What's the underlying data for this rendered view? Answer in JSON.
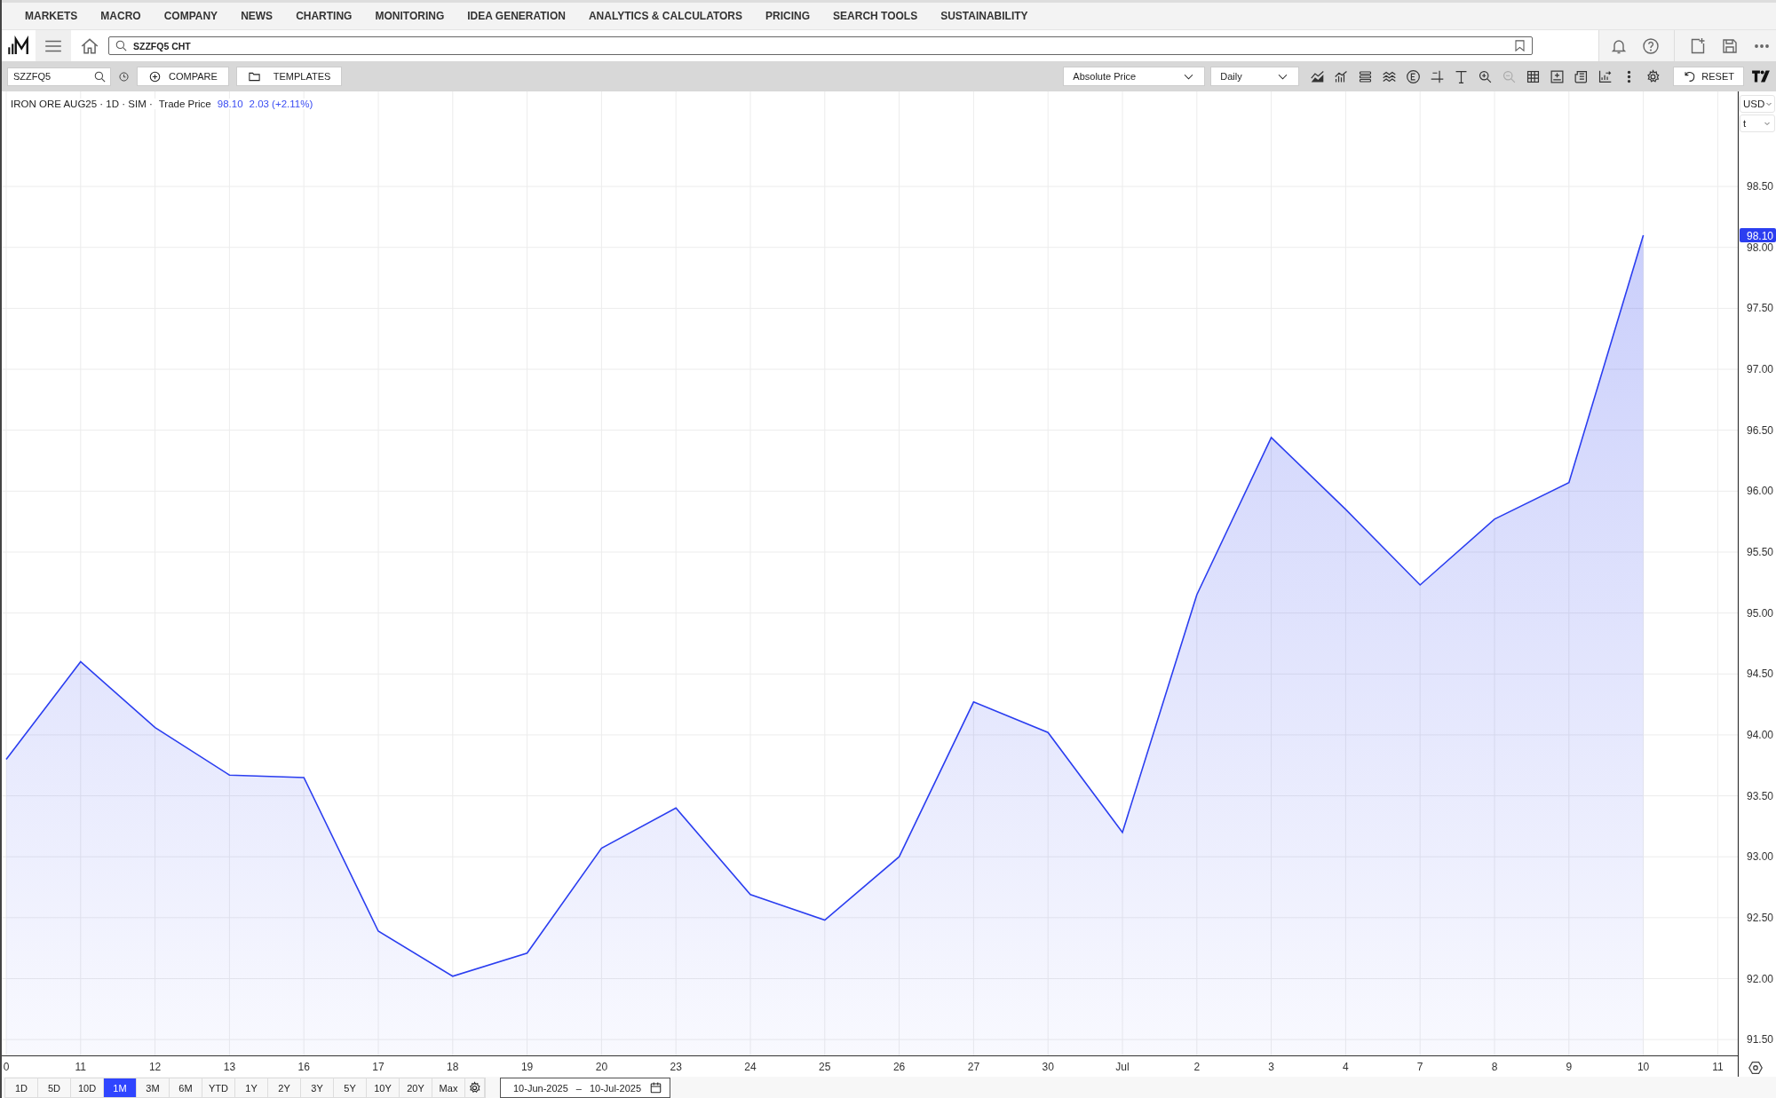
{
  "nav": {
    "items": [
      {
        "label": "MARKETS"
      },
      {
        "label": "MACRO"
      },
      {
        "label": "COMPANY"
      },
      {
        "label": "NEWS"
      },
      {
        "label": "CHARTING"
      },
      {
        "label": "MONITORING"
      },
      {
        "label": "IDEA GENERATION"
      },
      {
        "label": "ANALYTICS & CALCULATORS"
      },
      {
        "label": "PRICING"
      },
      {
        "label": "SEARCH TOOLS"
      },
      {
        "label": "SUSTAINABILITY"
      }
    ]
  },
  "command_bar": {
    "search_value": "SZZFQ5 CHT"
  },
  "toolbar": {
    "symbol_value": "SZZFQ5",
    "compare_label": "COMPARE",
    "templates_label": "TEMPLATES",
    "price_mode": "Absolute Price",
    "frequency": "Daily",
    "tools": [
      {
        "kind": "area",
        "disabled": false
      },
      {
        "kind": "indicators",
        "disabled": false
      },
      {
        "kind": "stack",
        "disabled": false
      },
      {
        "kind": "waves",
        "disabled": false
      },
      {
        "kind": "events",
        "disabled": false
      },
      {
        "kind": "crosshair",
        "disabled": false
      },
      {
        "kind": "text",
        "disabled": false
      },
      {
        "kind": "zoom-in",
        "disabled": false
      },
      {
        "kind": "zoom-out",
        "disabled": true
      },
      {
        "kind": "table",
        "disabled": false
      },
      {
        "kind": "frame",
        "disabled": false
      },
      {
        "kind": "news",
        "disabled": false
      },
      {
        "kind": "export",
        "disabled": false
      },
      {
        "kind": "more",
        "disabled": false
      },
      {
        "kind": "settings",
        "disabled": false
      }
    ],
    "reset_label": "RESET"
  },
  "chart": {
    "legend": {
      "title": "IRON ORE AUG25 · 1D · SIM ·",
      "last": "98.10",
      "change": "2.03 (+2.11%)"
    },
    "currency": "USD",
    "unit": "t",
    "last_price_label": "98.10",
    "chart_data": {
      "type": "area",
      "grid": true,
      "categories": [
        "0",
        "11",
        "12",
        "13",
        "16",
        "17",
        "18",
        "19",
        "20",
        "23",
        "24",
        "25",
        "26",
        "27",
        "30",
        "Jul",
        "2",
        "3",
        "4",
        "7",
        "8",
        "9",
        "10",
        "11"
      ],
      "series": [
        {
          "name": "Trade Price",
          "color": "#2b3ef0",
          "values": [
            93.8,
            94.6,
            94.06,
            93.67,
            93.65,
            92.39,
            92.02,
            92.21,
            93.07,
            93.4,
            92.69,
            92.48,
            93.0,
            94.27,
            94.02,
            93.2,
            95.15,
            96.44,
            95.85,
            95.23,
            95.77,
            96.07,
            98.1,
            null
          ]
        }
      ],
      "ylim": [
        91.37,
        99.28
      ],
      "yticks": [
        {
          "value": 91.5,
          "label": "91.50"
        },
        {
          "value": 92,
          "label": "92.00"
        },
        {
          "value": 92.5,
          "label": "92.50"
        },
        {
          "value": 93,
          "label": "93.00"
        },
        {
          "value": 93.5,
          "label": "93.50"
        },
        {
          "value": 94,
          "label": "94.00"
        },
        {
          "value": 94.5,
          "label": "94.50"
        },
        {
          "value": 95,
          "label": "95.00"
        },
        {
          "value": 95.5,
          "label": "95.50"
        },
        {
          "value": 96,
          "label": "96.00"
        },
        {
          "value": 96.5,
          "label": "96.50"
        },
        {
          "value": 97,
          "label": "97.00"
        },
        {
          "value": 97.5,
          "label": "97.50"
        },
        {
          "value": 98,
          "label": "98.00"
        },
        {
          "value": 98.5,
          "label": "98.50"
        }
      ]
    }
  },
  "ranges": [
    {
      "label": "1D",
      "selected": false
    },
    {
      "label": "5D",
      "selected": false
    },
    {
      "label": "10D",
      "selected": false
    },
    {
      "label": "1M",
      "selected": true
    },
    {
      "label": "3M",
      "selected": false
    },
    {
      "label": "6M",
      "selected": false
    },
    {
      "label": "YTD",
      "selected": false
    },
    {
      "label": "1Y",
      "selected": false
    },
    {
      "label": "2Y",
      "selected": false
    },
    {
      "label": "3Y",
      "selected": false
    },
    {
      "label": "5Y",
      "selected": false
    },
    {
      "label": "10Y",
      "selected": false
    },
    {
      "label": "20Y",
      "selected": false
    },
    {
      "label": "Max",
      "selected": false
    }
  ],
  "date_range": {
    "from": "10-Jun-2025",
    "separator": "–",
    "to": "10-Jul-2025"
  }
}
